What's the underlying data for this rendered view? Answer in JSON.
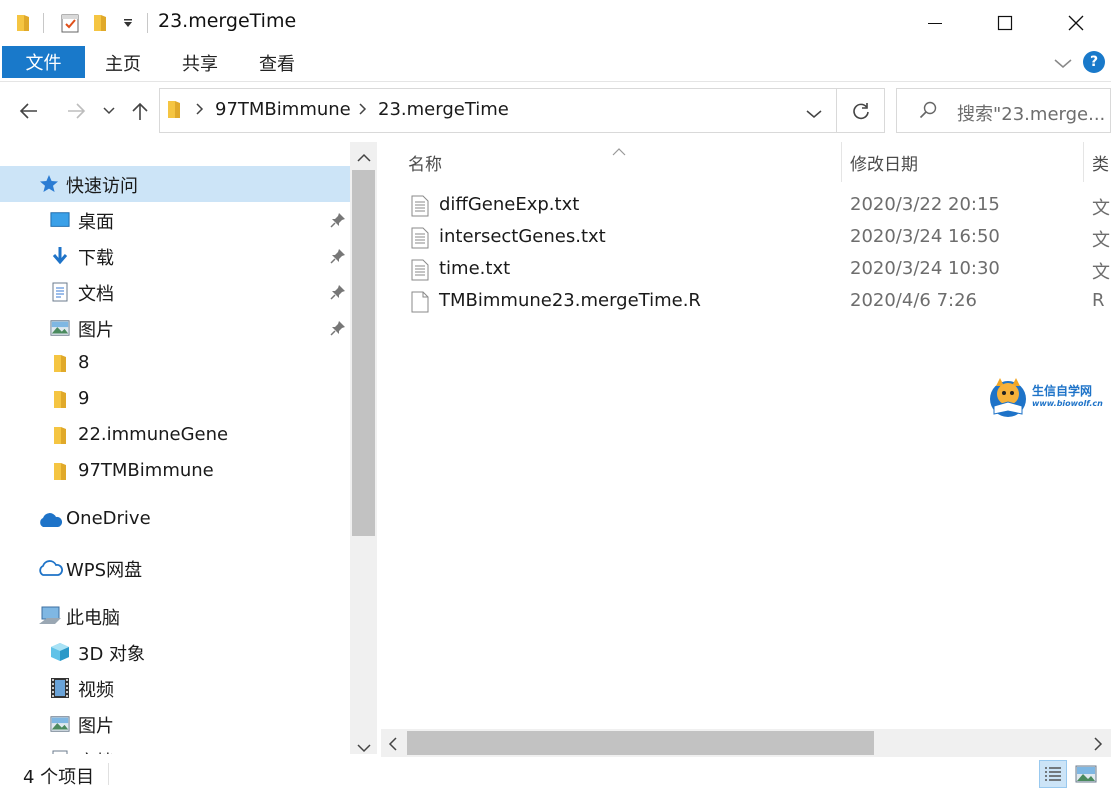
{
  "window": {
    "title": "23.mergeTime"
  },
  "ribbon": {
    "tabs": [
      "文件",
      "主页",
      "共享",
      "查看"
    ]
  },
  "address": {
    "crumbs": [
      "97TMBimmune",
      "23.mergeTime"
    ],
    "search_placeholder": "搜索\"23.merge..."
  },
  "nav": {
    "quick_access": "快速访问",
    "items": [
      {
        "label": "桌面",
        "icon": "desktop-icon",
        "pinned": true
      },
      {
        "label": "下载",
        "icon": "download-icon",
        "pinned": true
      },
      {
        "label": "文档",
        "icon": "documents-icon",
        "pinned": true
      },
      {
        "label": "图片",
        "icon": "pictures-icon",
        "pinned": true
      },
      {
        "label": "8",
        "icon": "folder-icon",
        "pinned": false
      },
      {
        "label": "9",
        "icon": "folder-icon",
        "pinned": false
      },
      {
        "label": "22.immuneGene",
        "icon": "folder-icon",
        "pinned": false
      },
      {
        "label": "97TMBimmune",
        "icon": "folder-icon",
        "pinned": false
      }
    ],
    "onedrive": "OneDrive",
    "wps": "WPS网盘",
    "this_pc": "此电脑",
    "pc_items": [
      {
        "label": "3D 对象",
        "icon": "3d-objects-icon"
      },
      {
        "label": "视频",
        "icon": "videos-icon"
      },
      {
        "label": "图片",
        "icon": "pictures-icon"
      },
      {
        "label": "文档",
        "icon": "documents-icon"
      }
    ]
  },
  "content": {
    "columns": {
      "name": "名称",
      "date": "修改日期",
      "type": "类"
    },
    "files": [
      {
        "name": "diffGeneExp.txt",
        "date": "2020/3/22 20:15",
        "type": "文",
        "icon": "text-file-icon"
      },
      {
        "name": "intersectGenes.txt",
        "date": "2020/3/24 16:50",
        "type": "文",
        "icon": "text-file-icon"
      },
      {
        "name": "time.txt",
        "date": "2020/3/24 10:30",
        "type": "文",
        "icon": "text-file-icon"
      },
      {
        "name": "TMBimmune23.mergeTime.R",
        "date": "2020/4/6 7:26",
        "type": "R",
        "icon": "blank-file-icon"
      }
    ]
  },
  "watermark": {
    "name": "生信自学网",
    "url": "www.biowolf.cn"
  },
  "status": {
    "count": "4 个项目"
  },
  "colors": {
    "accent": "#1979ca",
    "selection": "#cce4f7",
    "folder": "#f5c542"
  }
}
